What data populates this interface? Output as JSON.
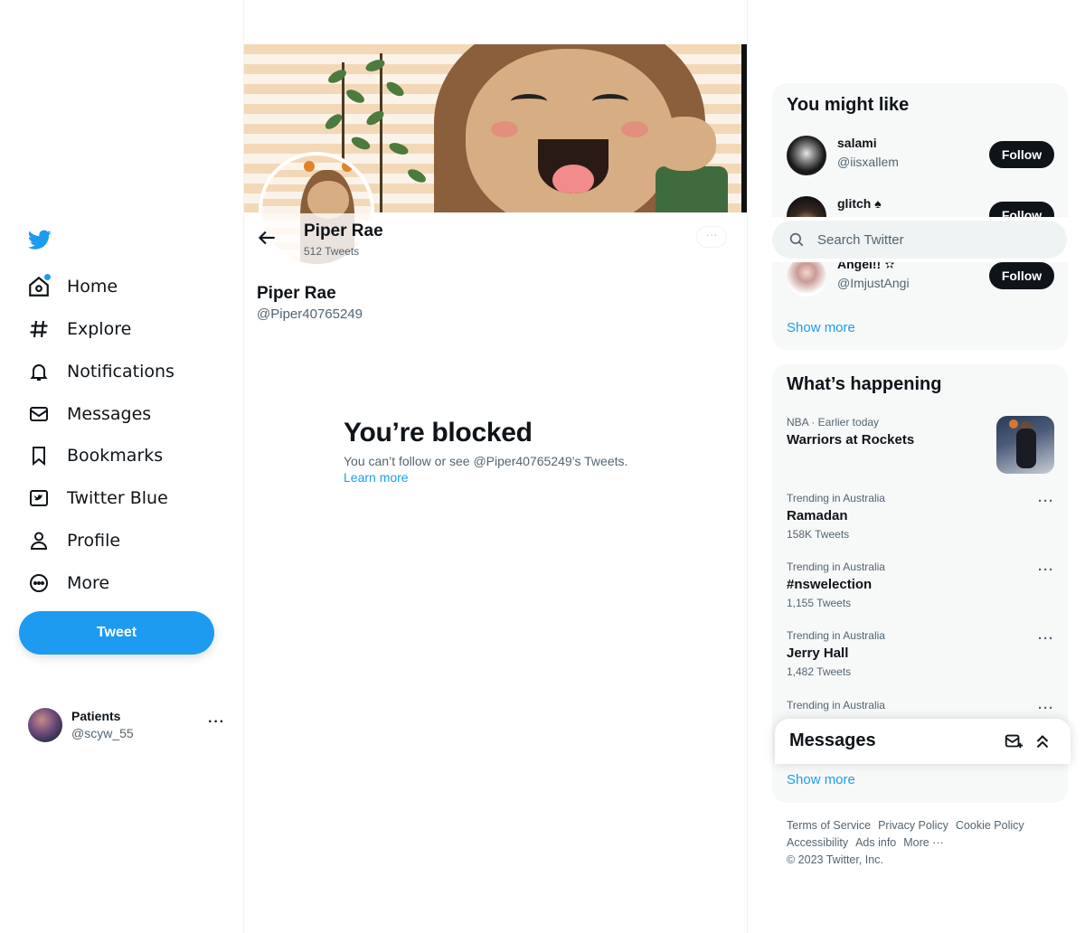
{
  "nav": {
    "items": [
      {
        "label": "Home",
        "icon": "home-icon",
        "notify": true
      },
      {
        "label": "Explore",
        "icon": "hashtag-icon"
      },
      {
        "label": "Notifications",
        "icon": "bell-icon"
      },
      {
        "label": "Messages",
        "icon": "envelope-icon"
      },
      {
        "label": "Bookmarks",
        "icon": "bookmark-icon"
      },
      {
        "label": "Twitter Blue",
        "icon": "twitter-blue-icon"
      },
      {
        "label": "Profile",
        "icon": "person-icon"
      },
      {
        "label": "More",
        "icon": "more-circle-icon"
      }
    ],
    "tweet_label": "Tweet",
    "account": {
      "name": "Patients",
      "handle": "@scyw_55",
      "more": "···"
    }
  },
  "profile": {
    "header_name": "Piper Rae",
    "tweet_count": "512 Tweets",
    "name": "Piper Rae",
    "handle": "@Piper40765249",
    "more": "···"
  },
  "blocked": {
    "title": "You’re blocked",
    "description": "You can’t follow or see @Piper40765249’s Tweets.",
    "learn_more": "Learn more"
  },
  "search": {
    "placeholder": "Search Twitter"
  },
  "who_to_follow": {
    "title": "You might like",
    "users": [
      {
        "name": "salami",
        "handle": "@iisxallem",
        "button": "Follow"
      },
      {
        "name": "glitch ♠",
        "handle": "",
        "button": "Follow"
      },
      {
        "name": "Angel!! ✫",
        "handle": "@ImjustAngi",
        "button": "Follow"
      }
    ],
    "show_more": "Show more"
  },
  "trends": {
    "title": "What’s happening",
    "featured": {
      "context": "NBA · Earlier today",
      "title": "Warriors at Rockets"
    },
    "items": [
      {
        "context": "Trending in Australia",
        "title": "Ramadan",
        "count": "158K Tweets",
        "more": "···"
      },
      {
        "context": "Trending in Australia",
        "title": "#nswelection",
        "count": "1,155 Tweets",
        "more": "···"
      },
      {
        "context": "Trending in Australia",
        "title": "Jerry Hall",
        "count": "1,482 Tweets",
        "more": "···"
      },
      {
        "context": "Trending in Australia",
        "title": "",
        "count": "",
        "more": "···"
      }
    ],
    "show_more": "Show more"
  },
  "messages_drawer": {
    "title": "Messages"
  },
  "footer": {
    "links": [
      "Terms of Service",
      "Privacy Policy",
      "Cookie Policy",
      "Accessibility",
      "Ads info",
      "More ···"
    ],
    "copyright": "© 2023 Twitter, Inc."
  },
  "colors": {
    "accent": "#1d9bf0",
    "text": "#0f1419",
    "muted": "#536471",
    "panel": "#f7f9f9"
  }
}
